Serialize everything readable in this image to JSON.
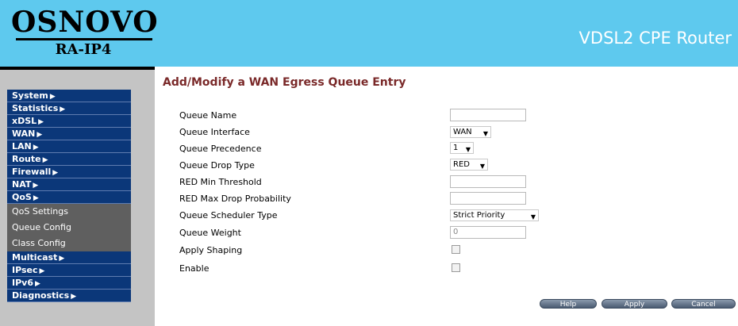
{
  "header": {
    "brand": "OSNOVO",
    "model": "RA-IP4",
    "product": "VDSL2 CPE Router"
  },
  "sidebar": {
    "items": [
      {
        "label": "System",
        "arrow": "▶"
      },
      {
        "label": "Statistics",
        "arrow": "▶"
      },
      {
        "label": "xDSL",
        "arrow": "▶"
      },
      {
        "label": "WAN",
        "arrow": "▶"
      },
      {
        "label": "LAN",
        "arrow": "▶"
      },
      {
        "label": "Route",
        "arrow": "▶"
      },
      {
        "label": "Firewall",
        "arrow": "▶"
      },
      {
        "label": "NAT",
        "arrow": "▶"
      },
      {
        "label": "QoS",
        "arrow": "▶"
      }
    ],
    "qos_sub": [
      "QoS Settings",
      "Queue Config",
      "Class Config"
    ],
    "items_after": [
      {
        "label": "Multicast",
        "arrow": "▶"
      },
      {
        "label": "IPsec",
        "arrow": "▶"
      },
      {
        "label": "IPv6",
        "arrow": "▶"
      },
      {
        "label": "Diagnostics",
        "arrow": "▶"
      }
    ]
  },
  "main": {
    "title": "Add/Modify a WAN Egress Queue Entry",
    "fields": {
      "queue_name": {
        "label": "Queue Name",
        "value": ""
      },
      "queue_interface": {
        "label": "Queue Interface",
        "value": "WAN"
      },
      "queue_precedence": {
        "label": "Queue Precedence",
        "value": "1"
      },
      "queue_drop_type": {
        "label": "Queue Drop Type",
        "value": "RED"
      },
      "red_min_threshold": {
        "label": "RED Min Threshold",
        "value": ""
      },
      "red_max_drop_probability": {
        "label": "RED Max Drop Probability",
        "value": ""
      },
      "queue_scheduler_type": {
        "label": "Queue Scheduler Type",
        "value": "Strict Priority"
      },
      "queue_weight": {
        "label": "Queue Weight",
        "value": "0"
      },
      "apply_shaping": {
        "label": "Apply Shaping",
        "checked": false
      },
      "enable": {
        "label": "Enable",
        "checked": false
      }
    },
    "caret": "▼",
    "buttons": {
      "help": "Help",
      "apply": "Apply",
      "cancel": "Cancel"
    }
  },
  "colors": {
    "header_bg": "#5ec9ee",
    "nav_bg": "#0b3779",
    "sub_bg": "#5f5f5f",
    "title": "#7a2929"
  }
}
